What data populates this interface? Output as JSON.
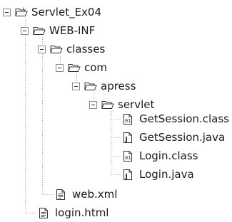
{
  "tree": {
    "root": {
      "label": "Servlet_Ex04",
      "icon": "project-folder-icon"
    },
    "web_inf": {
      "label": "WEB-INF",
      "icon": "open-folder-icon"
    },
    "classes": {
      "label": "classes",
      "icon": "open-folder-icon"
    },
    "com": {
      "label": "com",
      "icon": "open-folder-icon"
    },
    "apress": {
      "label": "apress",
      "icon": "open-folder-icon"
    },
    "servlet": {
      "label": "servlet",
      "icon": "open-folder-icon"
    },
    "getsession_class": {
      "label": "GetSession.class",
      "icon": "class-file-icon"
    },
    "getsession_java": {
      "label": "GetSession.java",
      "icon": "java-file-icon"
    },
    "login_class": {
      "label": "Login.class",
      "icon": "class-file-icon"
    },
    "login_java": {
      "label": "Login.java",
      "icon": "java-file-icon"
    },
    "web_xml": {
      "label": "web.xml",
      "icon": "document-file-icon"
    },
    "login_html": {
      "label": "login.html",
      "icon": "document-file-icon"
    }
  }
}
